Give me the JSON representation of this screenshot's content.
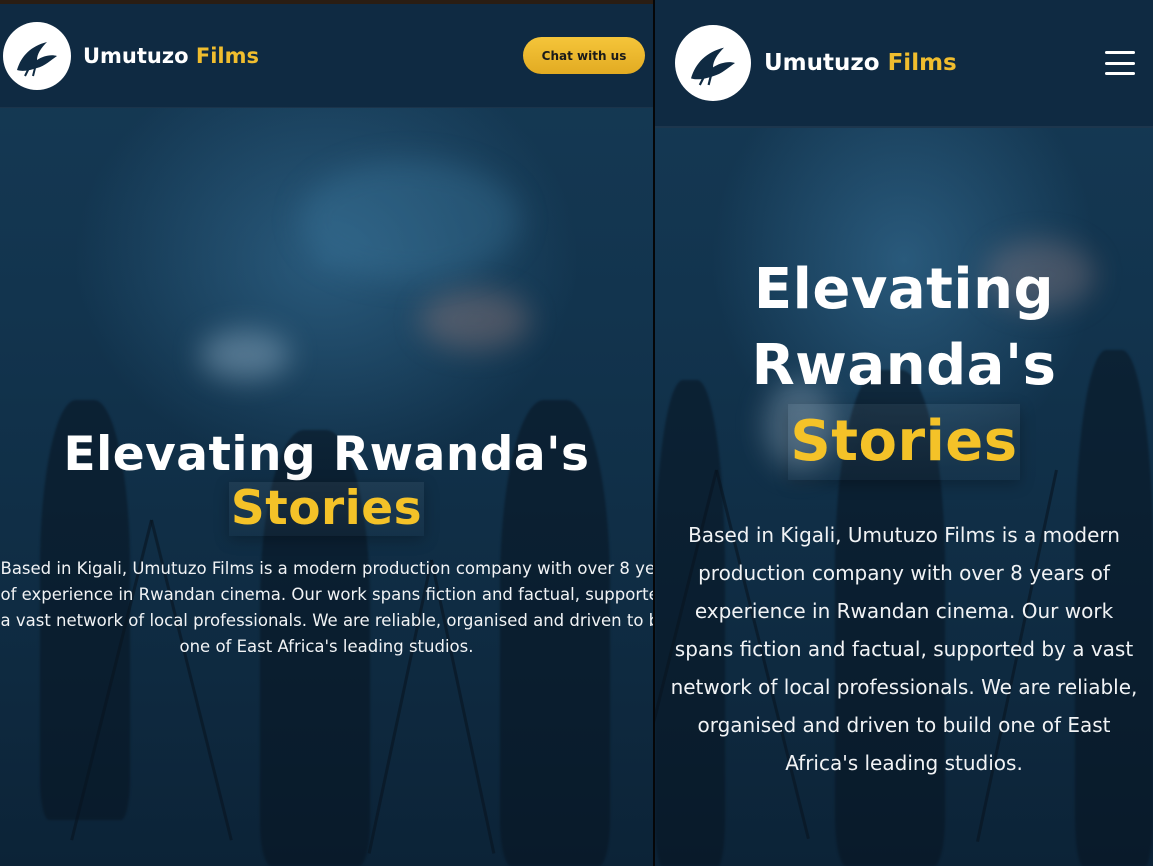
{
  "left_view": {
    "brand": {
      "name": "Umutuzo",
      "accent": "Films"
    },
    "chat_button": "Chat with us",
    "hero": {
      "title_line1": "Elevating Rwanda's",
      "title_highlight": "Stories",
      "description_lines": [
        "Based in Kigali, Umutuzo Films is a modern production company with over 8 ye",
        "of experience in Rwandan cinema. Our work spans fiction and factual, supported",
        "a vast network of local professionals. We are reliable, organised and driven to b",
        "one of East Africa's leading studios."
      ]
    }
  },
  "right_view": {
    "brand": {
      "name": "Umutuzo",
      "accent": "Films"
    },
    "menu_icon": "hamburger-menu-icon",
    "hero": {
      "title_line1": "Elevating",
      "title_line2": "Rwanda's",
      "title_highlight": "Stories",
      "description": "Based in Kigali, Umutuzo Films is a modern production company with over 8 years of experience in Rwandan cinema. Our work spans fiction and factual, supported by a vast network of local professionals. We are reliable, organised and driven to build one of East Africa's leading studios."
    }
  },
  "colors": {
    "navbar_bg": "#0f2a42",
    "brand_accent": "#f0bd2e",
    "cta_button": "#f5c53a",
    "highlight_text": "#f4c228",
    "hero_text": "#ffffff"
  }
}
